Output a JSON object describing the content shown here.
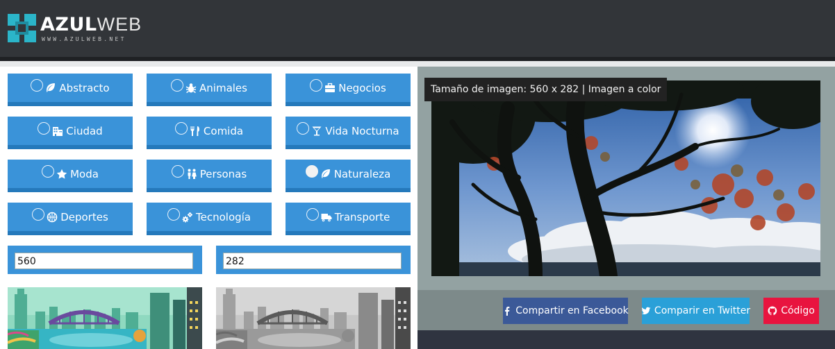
{
  "brand": {
    "name_bold": "AZUL",
    "name_light": "WEB",
    "url": "WWW.AZULWEB.NET"
  },
  "categories": [
    {
      "label": "Abstracto",
      "icon": "leaf-icon",
      "selected": false
    },
    {
      "label": "Animales",
      "icon": "bug-icon",
      "selected": false
    },
    {
      "label": "Negocios",
      "icon": "briefcase-icon",
      "selected": false
    },
    {
      "label": "Ciudad",
      "icon": "building-icon",
      "selected": false
    },
    {
      "label": "Comida",
      "icon": "cutlery-icon",
      "selected": false
    },
    {
      "label": "Vida Nocturna",
      "icon": "cocktail-icon",
      "selected": false
    },
    {
      "label": "Moda",
      "icon": "star-icon",
      "selected": false
    },
    {
      "label": "Personas",
      "icon": "people-icon",
      "selected": false
    },
    {
      "label": "Naturaleza",
      "icon": "leaf-icon",
      "selected": true
    },
    {
      "label": "Deportes",
      "icon": "basketball-icon",
      "selected": false
    },
    {
      "label": "Tecnología",
      "icon": "cogs-icon",
      "selected": false
    },
    {
      "label": "Transporte",
      "icon": "truck-icon",
      "selected": false
    }
  ],
  "dimensions": {
    "width": "560",
    "height": "282"
  },
  "modes": [
    "color",
    "grayscale"
  ],
  "preview": {
    "caption": "Tamaño de imagen: 560 x 282 | Imagen a color"
  },
  "share": {
    "facebook": "Compartir en Facebook",
    "twitter": "Comparir en Twitter",
    "code": "Código"
  },
  "colors": {
    "button": "#3a93d9",
    "facebook": "#3b5998",
    "twitter": "#2aa0d8",
    "code": "#e8143f",
    "header": "#323539"
  }
}
